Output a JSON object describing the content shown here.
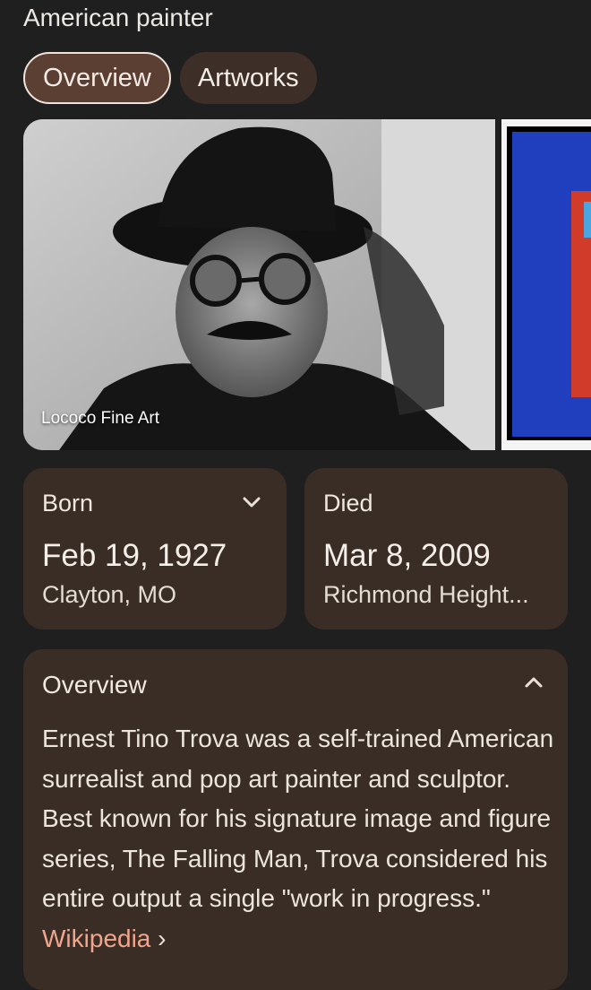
{
  "header": {
    "subtitle": "American painter"
  },
  "tabs": [
    {
      "label": "Overview",
      "active": true
    },
    {
      "label": "Artworks",
      "active": false
    }
  ],
  "gallery": {
    "photo_credit": "Lococo Fine Art"
  },
  "born": {
    "label": "Born",
    "date": "Feb 19, 1927",
    "place": "Clayton, MO",
    "icon": "chevron-down-icon"
  },
  "died": {
    "label": "Died",
    "date": "Mar 8, 2009",
    "place": "Richmond Height..."
  },
  "overview": {
    "label": "Overview",
    "icon": "chevron-up-icon",
    "text": "Ernest Tino Trova was a self-trained American surrealist and pop art painter and sculptor. Best known for his signature image and figure series, The Falling Man, Trova considered his entire output a single \"work in progress.\"",
    "link_label": "Wikipedia",
    "link_chevron": "›"
  },
  "colors": {
    "background": "#1f1f1f",
    "card": "#3a2d26",
    "tab_active": "#5b3f33",
    "link": "#f2a58b"
  }
}
